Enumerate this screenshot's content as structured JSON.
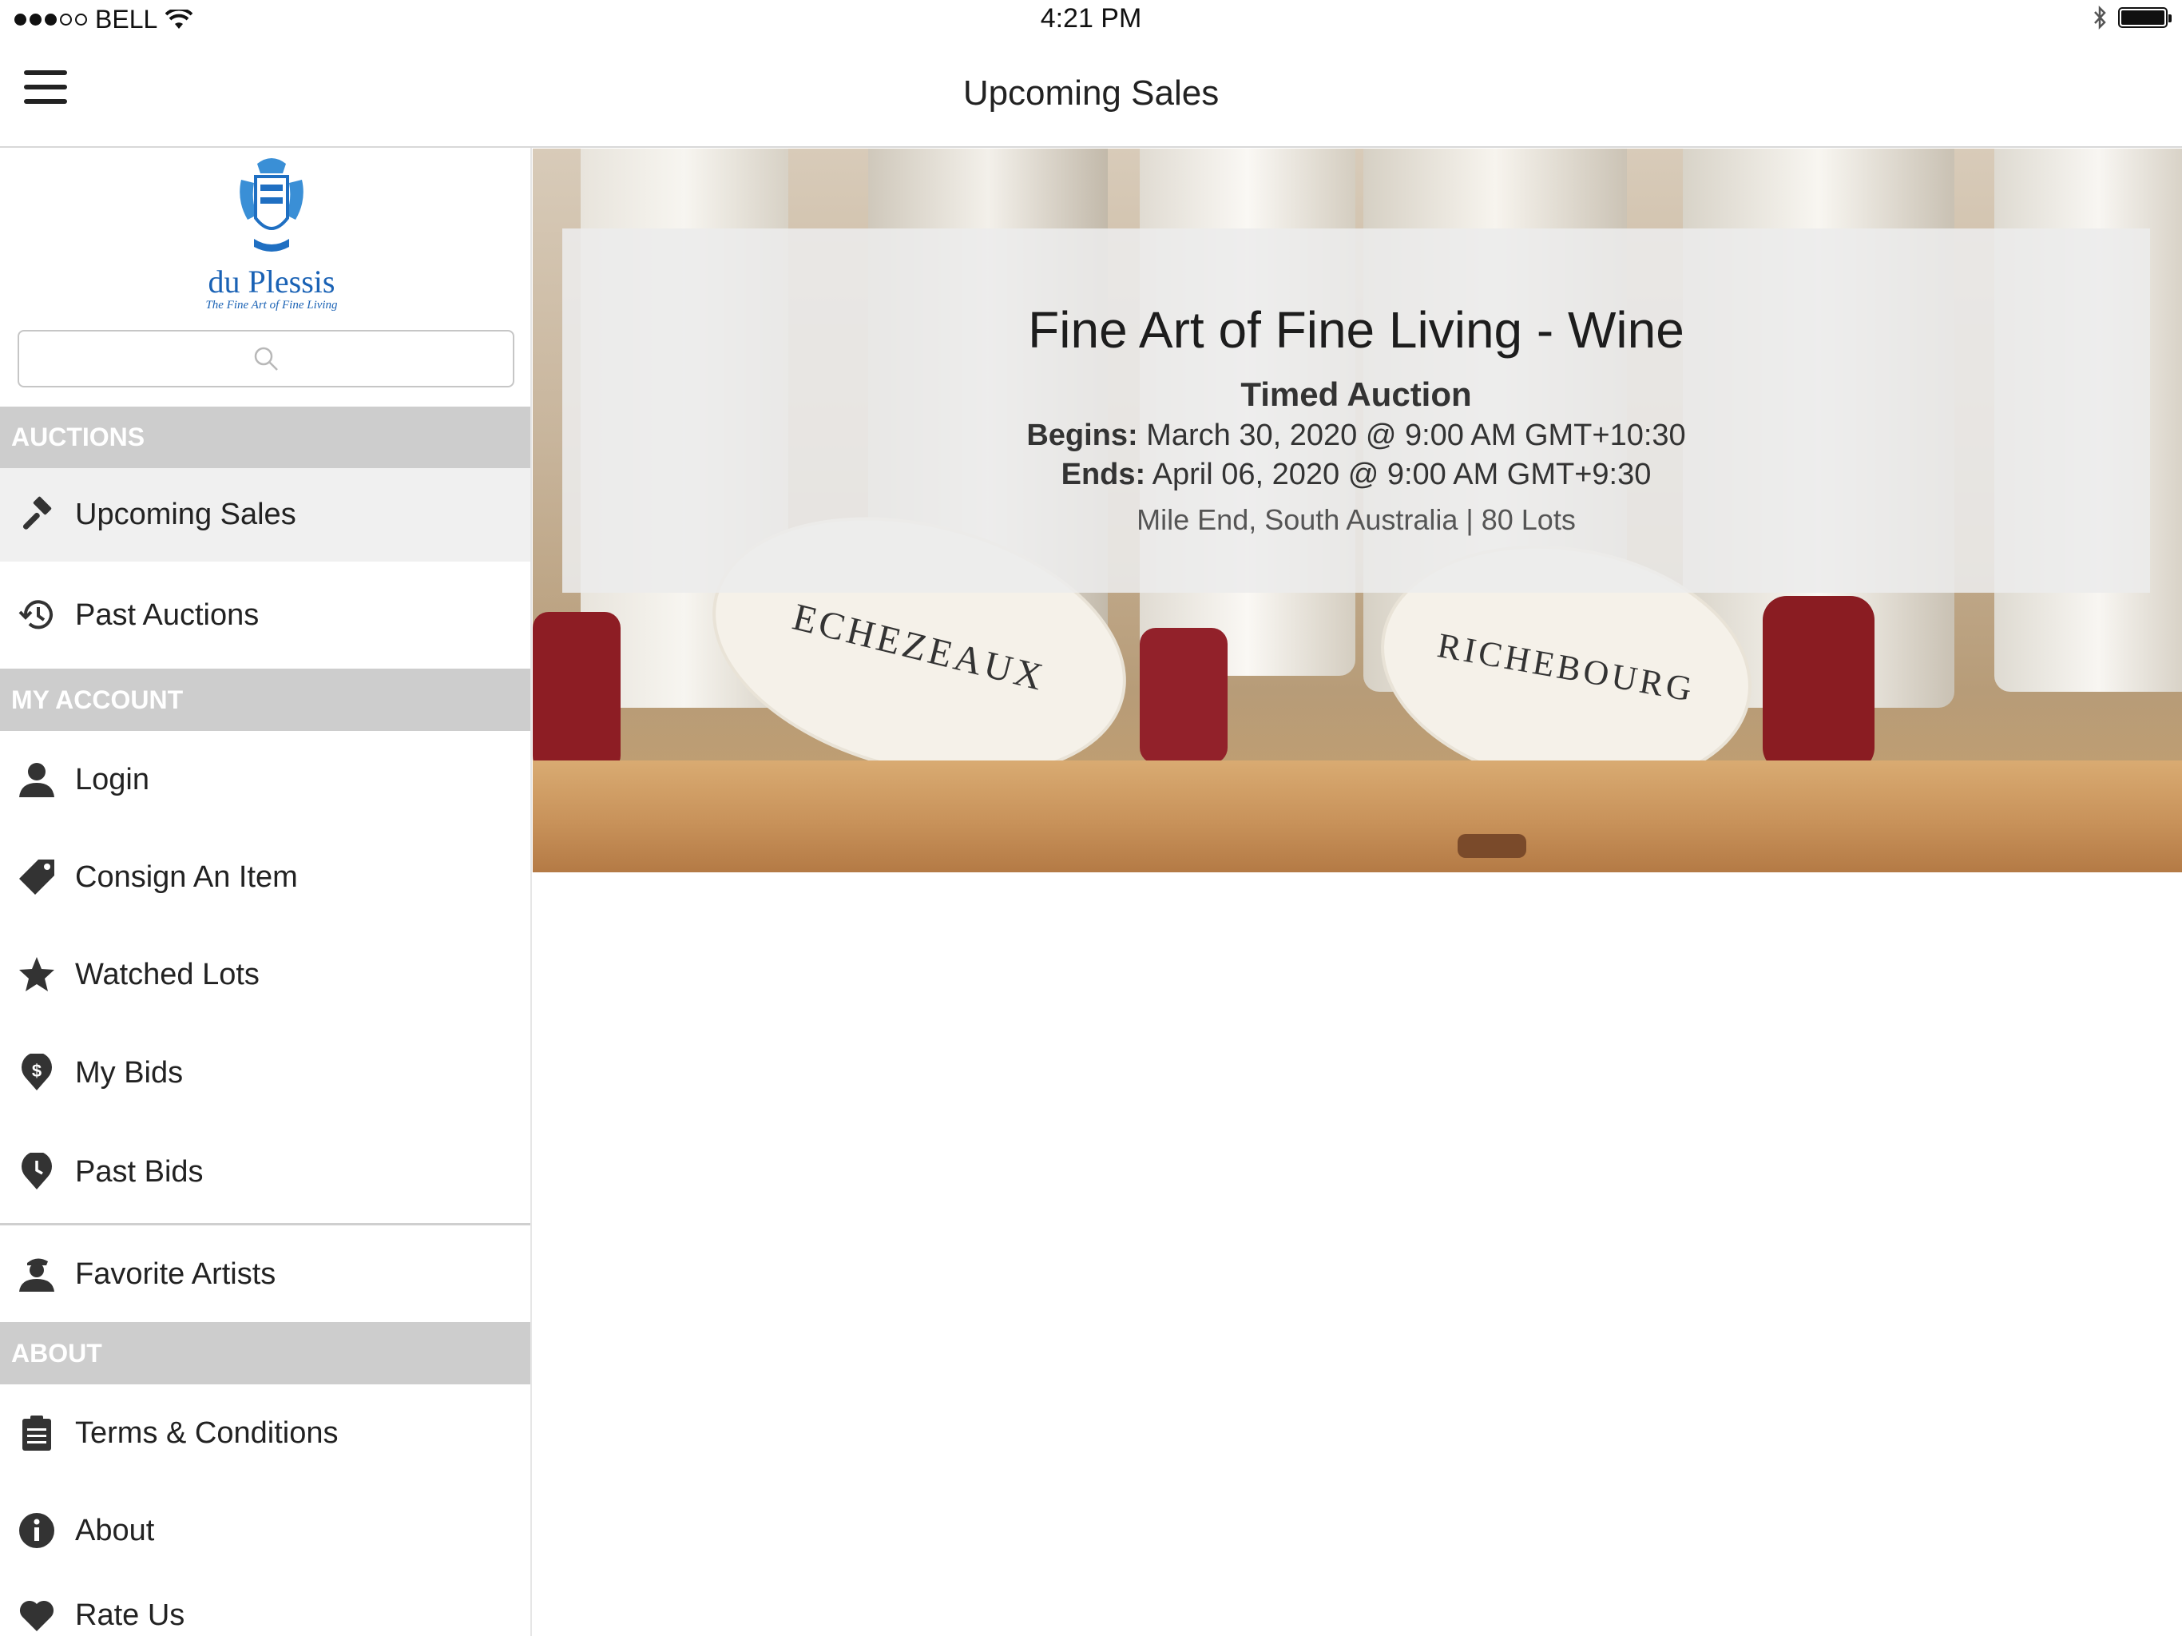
{
  "status_bar": {
    "carrier": "BELL",
    "time": "4:21 PM"
  },
  "nav": {
    "title": "Upcoming Sales"
  },
  "brand": {
    "name": "du Plessis",
    "tagline": "The Fine Art of Fine Living"
  },
  "sidebar": {
    "search_placeholder": "",
    "sections": {
      "auctions": "AUCTIONS",
      "my_account": "MY ACCOUNT",
      "about": "ABOUT"
    },
    "items": {
      "upcoming_sales": "Upcoming Sales",
      "past_auctions": "Past Auctions",
      "login": "Login",
      "consign": "Consign An Item",
      "watched_lots": "Watched Lots",
      "my_bids": "My Bids",
      "past_bids": "Past Bids",
      "favorite_artists": "Favorite Artists",
      "terms": "Terms & Conditions",
      "about": "About",
      "rate_us": "Rate Us"
    }
  },
  "sale": {
    "title": "Fine Art of Fine Living - Wine",
    "type": "Timed Auction",
    "begins_label": "Begins:",
    "begins_value": "March 30, 2020 @ 9:00 AM GMT+10:30",
    "ends_label": "Ends:",
    "ends_value": "April 06, 2020 @ 9:00 AM GMT+9:30",
    "location_lots": "Mile End, South Australia | 80 Lots",
    "image_text": {
      "left_label": "ECHEZEAUX",
      "right_label": "RICHEBOURG"
    }
  }
}
